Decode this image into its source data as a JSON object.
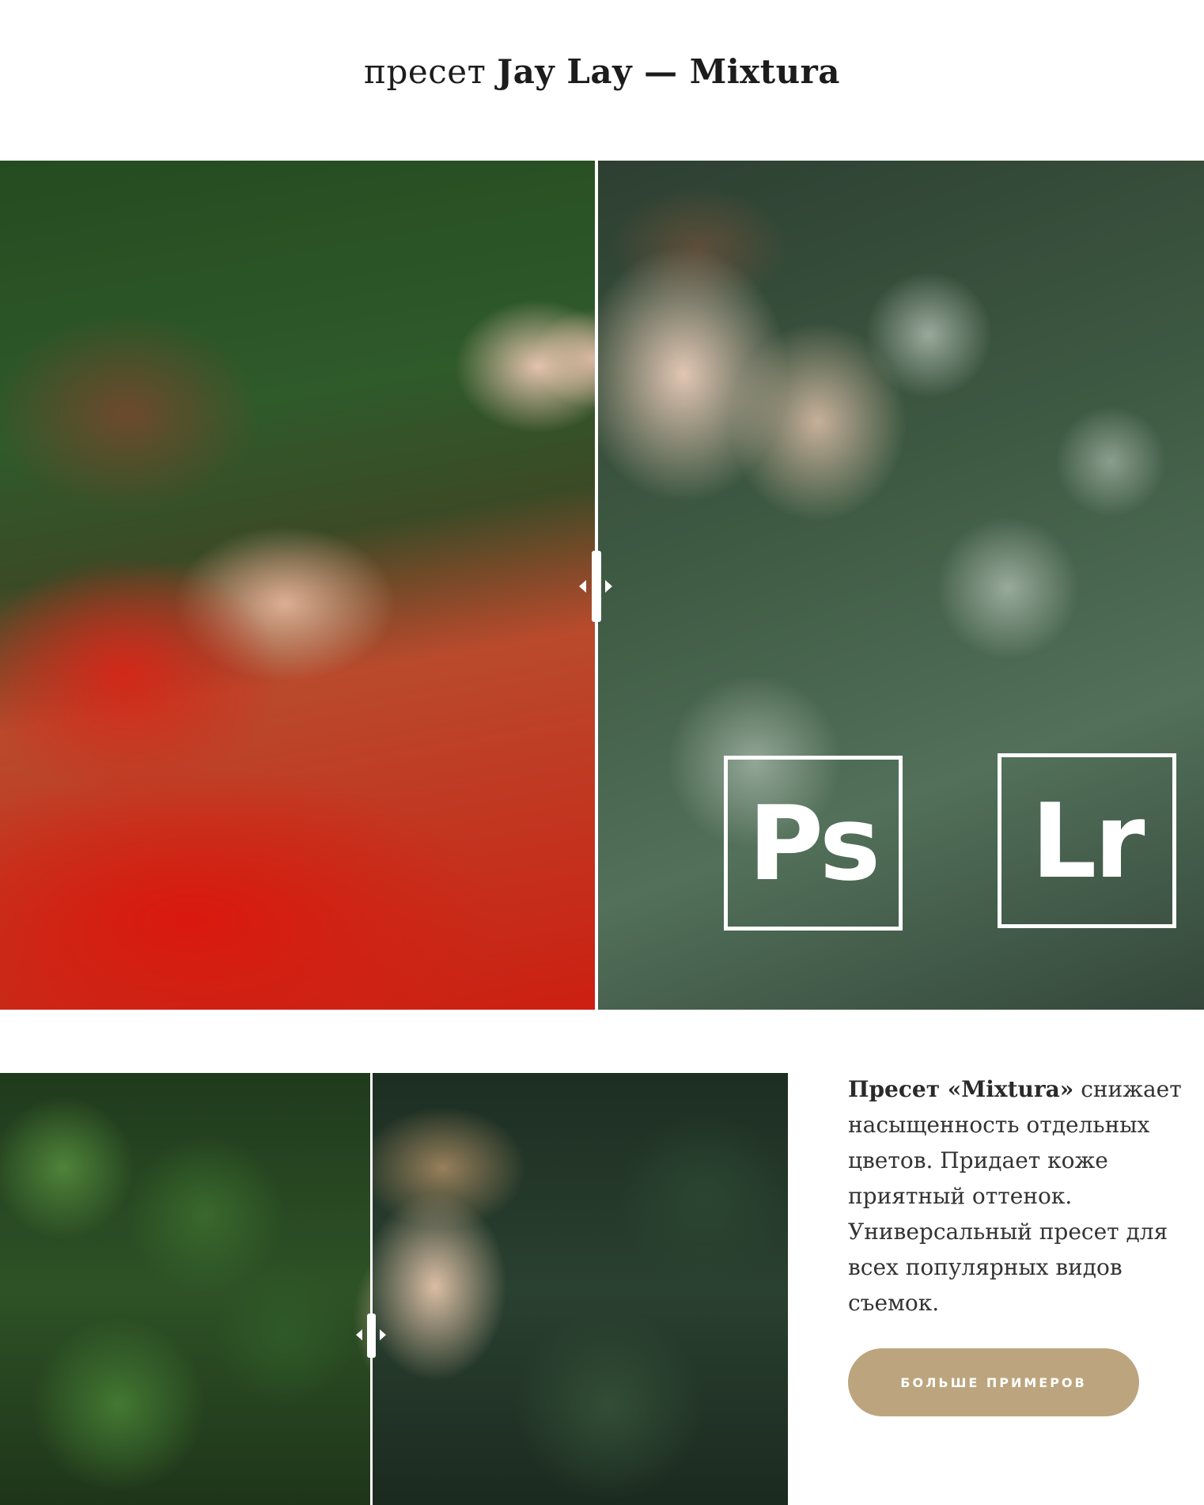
{
  "header": {
    "title_prefix": "пресет",
    "title_bold": "Jay Lay — Mixtura"
  },
  "comparison_top": {
    "divider_percent": 49.5,
    "badges": {
      "photoshop": "Ps",
      "lightroom": "Lr"
    }
  },
  "comparison_bottom": {
    "divider_percent": 47.2
  },
  "description": {
    "preset_name": "Пресет «Mixtura»",
    "text": " снижает насыщенность отдельных цветов. Придает коже приятный оттенок. Универсальный пресет для всех популярных видов съемок."
  },
  "cta": {
    "label": "Больше примеров"
  },
  "colors": {
    "accent": "#bca57e",
    "text": "#333333",
    "background": "#ffffff"
  }
}
